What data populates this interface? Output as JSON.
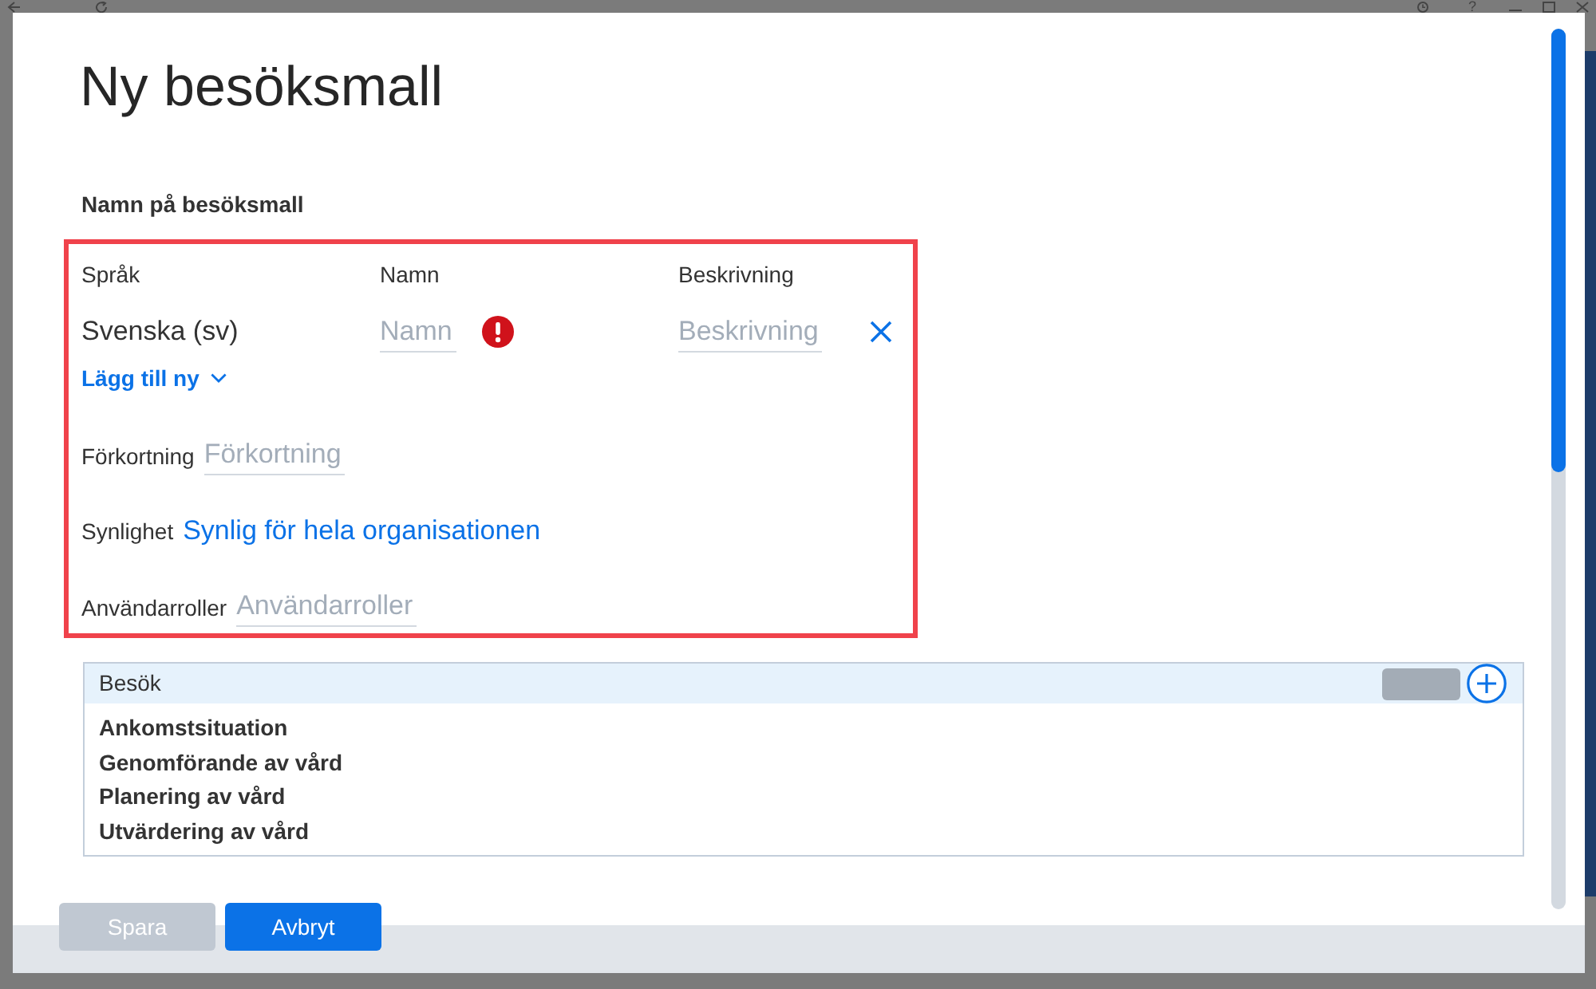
{
  "background_toolbar": {
    "help": "?"
  },
  "dialog": {
    "title": "Ny besöksmall",
    "section_label": "Namn på besöksmall",
    "form": {
      "highlighted": true,
      "translations": {
        "columns": [
          "Språk",
          "Namn",
          "Beskrivning"
        ],
        "rows": [
          {
            "language": "Svenska (sv)",
            "name": {
              "placeholder": "Namn",
              "error": true
            },
            "description": {
              "placeholder": "Beskrivning"
            }
          }
        ],
        "add_link": "Lägg till ny"
      },
      "fields": [
        {
          "kind": "input",
          "label": "Förkortning",
          "placeholder": "Förkortning"
        },
        {
          "kind": "link",
          "label": "Synlighet",
          "value": "Synlig för hela organisationen"
        },
        {
          "kind": "input",
          "label": "Användarroller",
          "placeholder": "Användarroller"
        }
      ]
    },
    "visit_list": {
      "title": "Besök",
      "items": [
        "Ankomstsituation",
        "Genomförande av vård",
        "Planering av vård",
        "Utvärdering av vård"
      ]
    },
    "buttons": [
      {
        "label": "Spara",
        "disabled": true
      },
      {
        "label": "Avbryt",
        "disabled": false
      }
    ]
  }
}
